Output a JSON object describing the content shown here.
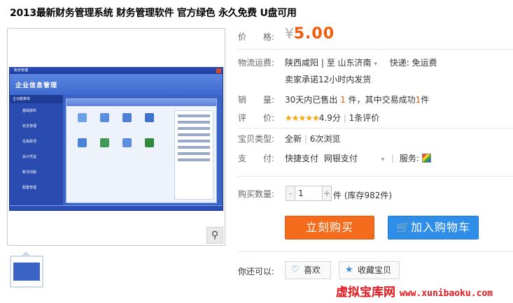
{
  "title": "2013最新财务管理系统 财务管理软件 官方绿色 永久免费 U盘可用",
  "screenshot": {
    "window_title": "账务管理",
    "header_title": "企业信息管理",
    "menu_header": "主功能菜单",
    "menu": [
      "基础资料",
      "收支管理",
      "往来款项",
      "会计凭证",
      "账书功能",
      "配置管理"
    ]
  },
  "price": {
    "label": "价　　格:",
    "currency": "¥",
    "value": "5.00"
  },
  "shipping": {
    "label": "物流运费:",
    "from": "陕西咸阳",
    "to_sep": "| 至",
    "to": "山东济南",
    "method": "快递: 免运费",
    "promise": "卖家承诺12小时内发货"
  },
  "sales": {
    "label": "销　　量:",
    "prefix": "30天内已售出",
    "count": "1",
    "mid": "件，其中交易成功",
    "success": "1",
    "suffix": "件"
  },
  "rating": {
    "label": "评　　价:",
    "stars": "★★★★★",
    "score": "4.9分",
    "reviews": "1条评价"
  },
  "type": {
    "label": "宝贝类型:",
    "condition": "全新",
    "views": "6次浏览"
  },
  "payment": {
    "label": "支　　付:",
    "methods": [
      "快捷支付",
      "网银支付"
    ],
    "service_label": "服务:"
  },
  "quantity": {
    "label": "购买数量:",
    "minus": "-",
    "plus": "+",
    "value": "1",
    "unit": "件 (库存982件)"
  },
  "buttons": {
    "buy": "立刻购买",
    "cart": "加入购物车"
  },
  "extra": {
    "label": "你还可以:",
    "like": "喜欢",
    "favorite": "收藏宝贝"
  },
  "watermark": {
    "cn": "虚拟宝库网",
    "url": "www.xunibaoku.com"
  },
  "colors": {
    "price": "#f25a06",
    "buy_button": "#f46c1b",
    "cart_button": "#2f8ee8",
    "watermark": "#e4161b"
  }
}
